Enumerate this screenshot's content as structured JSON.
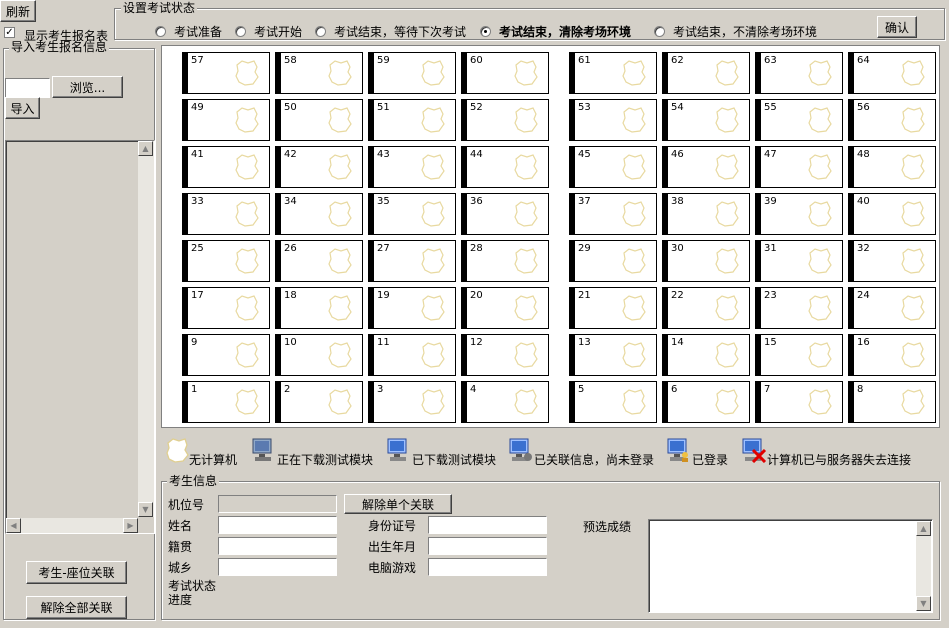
{
  "toolbar": {
    "refresh_label": "刷新"
  },
  "left_panel": {
    "show_table_label": "显示考生报名表",
    "show_table_checked": true,
    "import_group_title": "导入考生报名信息",
    "file_value": "",
    "browse_label": "浏览...",
    "import_label": "导入",
    "link_label": "考生-座位关联",
    "unlink_all_label": "解除全部关联"
  },
  "state": {
    "title": "设置考试状态",
    "options": [
      {
        "label": "考试准备",
        "selected": false
      },
      {
        "label": "考试开始",
        "selected": false
      },
      {
        "label": "考试结束，等待下次考试",
        "selected": false
      },
      {
        "label": "考试结束，清除考场环境",
        "selected": true
      },
      {
        "label": "考试结束，不清除考场环境",
        "selected": false
      }
    ],
    "confirm_label": "确认"
  },
  "seats": {
    "rows": [
      [
        "57",
        "58",
        "59",
        "60",
        "61",
        "62",
        "63",
        "64"
      ],
      [
        "49",
        "50",
        "51",
        "52",
        "53",
        "54",
        "55",
        "56"
      ],
      [
        "41",
        "42",
        "43",
        "44",
        "45",
        "46",
        "47",
        "48"
      ],
      [
        "33",
        "34",
        "35",
        "36",
        "37",
        "38",
        "39",
        "40"
      ],
      [
        "25",
        "26",
        "27",
        "28",
        "29",
        "30",
        "31",
        "32"
      ],
      [
        "17",
        "18",
        "19",
        "20",
        "21",
        "22",
        "23",
        "24"
      ],
      [
        "9",
        "10",
        "11",
        "12",
        "13",
        "14",
        "15",
        "16"
      ],
      [
        "1",
        "2",
        "3",
        "4",
        "5",
        "6",
        "7",
        "8"
      ]
    ]
  },
  "legend": [
    {
      "icon": "no-computer-icon",
      "label": "无计算机"
    },
    {
      "icon": "downloading-computer-icon",
      "label": "正在下载测试模块"
    },
    {
      "icon": "downloaded-computer-icon",
      "label": "已下载测试模块"
    },
    {
      "icon": "linked-info-computer-icon",
      "label": "已关联信息，尚未登录"
    },
    {
      "icon": "logged-in-computer-icon",
      "label": "已登录"
    },
    {
      "icon": "disconnected-computer-icon",
      "label": "计算机已与服务器失去连接"
    }
  ],
  "student": {
    "title": "考生信息",
    "seat_no_label": "机位号",
    "seat_no_value": "",
    "unlink_single_label": "解除单个关联",
    "name_label": "姓名",
    "name_value": "",
    "id_label": "身份证号",
    "id_value": "",
    "native_label": "籍贯",
    "native_value": "",
    "birth_label": "出生年月",
    "birth_value": "",
    "area_label": "城乡",
    "area_value": "",
    "game_label": "电脑游戏",
    "game_value": "",
    "exam_state_label": "考试状态",
    "progress_label": "进度",
    "prescore_label": "预选成绩",
    "prescore_value": ""
  },
  "colors": {
    "window_bg": "#d4d0c8",
    "seat_bg": "#ffffff",
    "empty_seat_outline": "#e8d9a0",
    "disconnect_x": "#e00000",
    "computer_blue": "#4a7ec0"
  }
}
